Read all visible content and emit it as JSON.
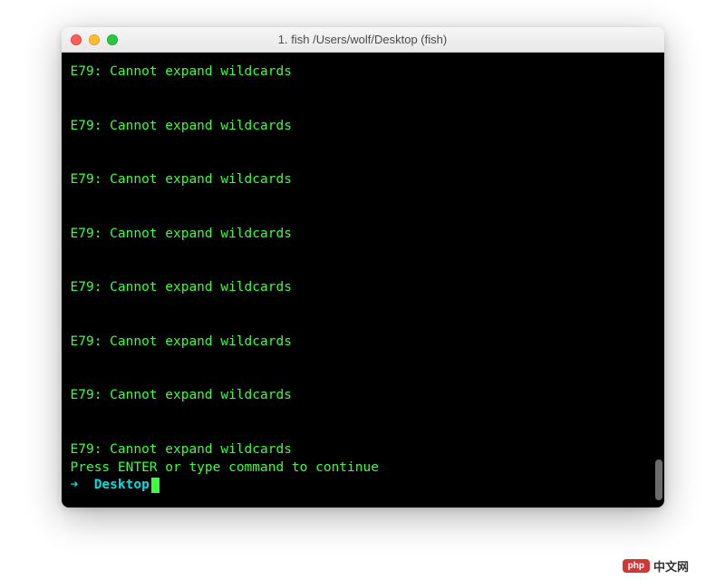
{
  "window": {
    "title": "1. fish  /Users/wolf/Desktop (fish)"
  },
  "terminal": {
    "errors": [
      "E79: Cannot expand wildcards",
      "E79: Cannot expand wildcards",
      "E79: Cannot expand wildcards",
      "E79: Cannot expand wildcards",
      "E79: Cannot expand wildcards",
      "E79: Cannot expand wildcards",
      "E79: Cannot expand wildcards",
      "E79: Cannot expand wildcards"
    ],
    "press_enter": "Press ENTER or type command to continue",
    "prompt": {
      "arrow": "➜  ",
      "cwd": "Desktop"
    }
  },
  "watermark": {
    "badge": "php",
    "text": "中文网"
  }
}
